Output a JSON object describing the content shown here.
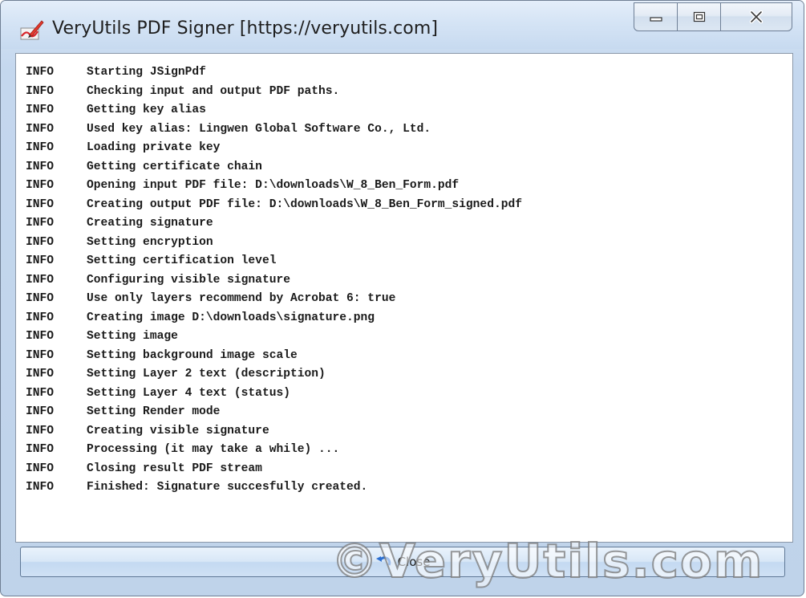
{
  "window": {
    "title": "VeryUtils PDF Signer [https://veryutils.com]",
    "caption_buttons": {
      "minimize_icon": "minimize-icon",
      "maximize_icon": "maximize-icon",
      "close_icon": "close-x-icon"
    }
  },
  "log": {
    "entries": [
      {
        "level": "INFO",
        "message": "Starting JSignPdf"
      },
      {
        "level": "INFO",
        "message": "Checking input and output PDF paths."
      },
      {
        "level": "INFO",
        "message": "Getting key alias"
      },
      {
        "level": "INFO",
        "message": "Used key alias: Lingwen Global Software Co., Ltd."
      },
      {
        "level": "INFO",
        "message": "Loading private key"
      },
      {
        "level": "INFO",
        "message": "Getting certificate chain"
      },
      {
        "level": "INFO",
        "message": "Opening input PDF file: D:\\downloads\\W_8_Ben_Form.pdf"
      },
      {
        "level": "INFO",
        "message": "Creating output PDF file: D:\\downloads\\W_8_Ben_Form_signed.pdf"
      },
      {
        "level": "INFO",
        "message": "Creating signature"
      },
      {
        "level": "INFO",
        "message": "Setting encryption"
      },
      {
        "level": "INFO",
        "message": "Setting certification level"
      },
      {
        "level": "INFO",
        "message": "Configuring visible signature"
      },
      {
        "level": "INFO",
        "message": "Use only layers recommend by Acrobat 6: true"
      },
      {
        "level": "INFO",
        "message": "Creating image D:\\downloads\\signature.png"
      },
      {
        "level": "INFO",
        "message": "Setting image"
      },
      {
        "level": "INFO",
        "message": "Setting background image scale"
      },
      {
        "level": "INFO",
        "message": "Setting Layer 2 text (description)"
      },
      {
        "level": "INFO",
        "message": "Setting Layer 4 text (status)"
      },
      {
        "level": "INFO",
        "message": "Setting Render mode"
      },
      {
        "level": "INFO",
        "message": "Creating visible signature"
      },
      {
        "level": "INFO",
        "message": "Processing (it may take a while) ..."
      },
      {
        "level": "INFO",
        "message": "Closing result PDF stream"
      },
      {
        "level": "INFO",
        "message": "Finished: Signature succesfully created."
      }
    ]
  },
  "close_button": {
    "label": "Close",
    "icon": "undo-arrow-icon"
  },
  "watermark": {
    "text": "©VeryUtils.com"
  }
}
